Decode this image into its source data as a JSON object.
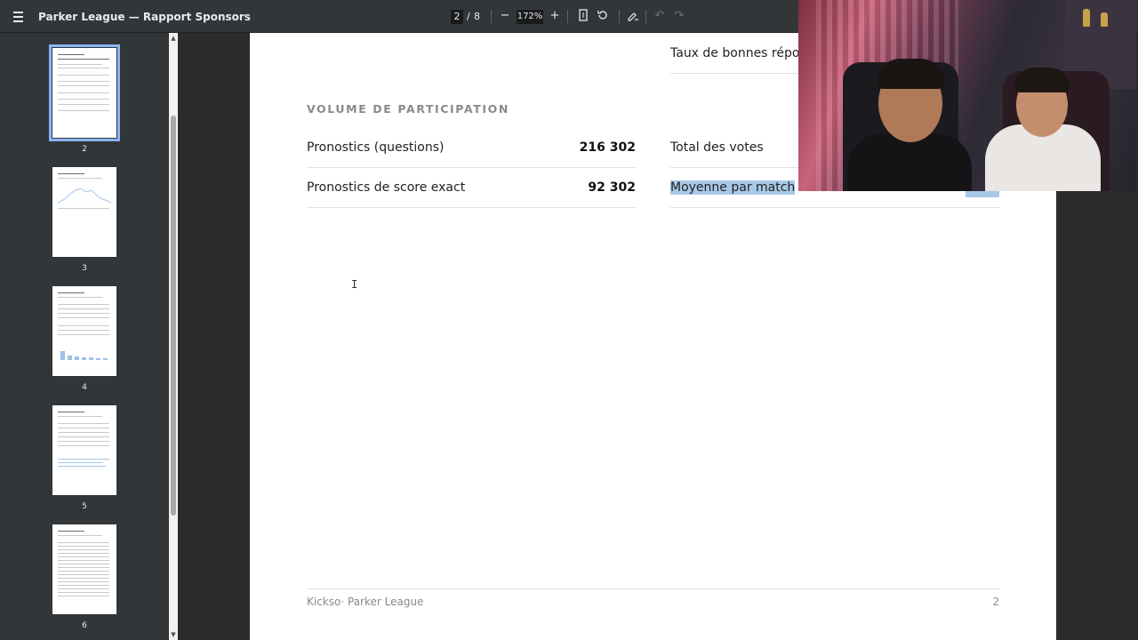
{
  "toolbar": {
    "title": "Parker League — Rapport Sponsors",
    "current_page": "2",
    "page_separator": "/",
    "total_pages": "8",
    "zoom": "172%"
  },
  "sidebar": {
    "thumbnails": [
      {
        "label": "2",
        "selected": true
      },
      {
        "label": "3",
        "selected": false
      },
      {
        "label": "4",
        "selected": false
      },
      {
        "label": "5",
        "selected": false
      },
      {
        "label": "6",
        "selected": false
      }
    ]
  },
  "document": {
    "top_right_label": "Taux de bonnes répon",
    "section_title": "VOLUME DE PARTICIPATION",
    "rows_left": [
      {
        "label": "Pronostics (questions)",
        "value": "216 302"
      },
      {
        "label": "Pronostics de score exact",
        "value": "92 302"
      }
    ],
    "rows_right": [
      {
        "label": "Total des votes"
      },
      {
        "label": "Moyenne par match"
      }
    ],
    "footer_left": "Kickso· Parker League",
    "footer_right": "2"
  },
  "icons": {
    "menu": "menu-icon",
    "zoom_out": "minus-icon",
    "zoom_in": "plus-icon",
    "fit": "fit-page-icon",
    "rotate": "rotate-icon",
    "annotate": "draw-icon",
    "undo": "undo-icon",
    "redo": "redo-icon"
  },
  "colors": {
    "toolbar_bg": "#323639",
    "viewer_bg": "#2b2b2b",
    "selection": "#a8c8e8",
    "thumb_selected": "#8ab4f8"
  }
}
